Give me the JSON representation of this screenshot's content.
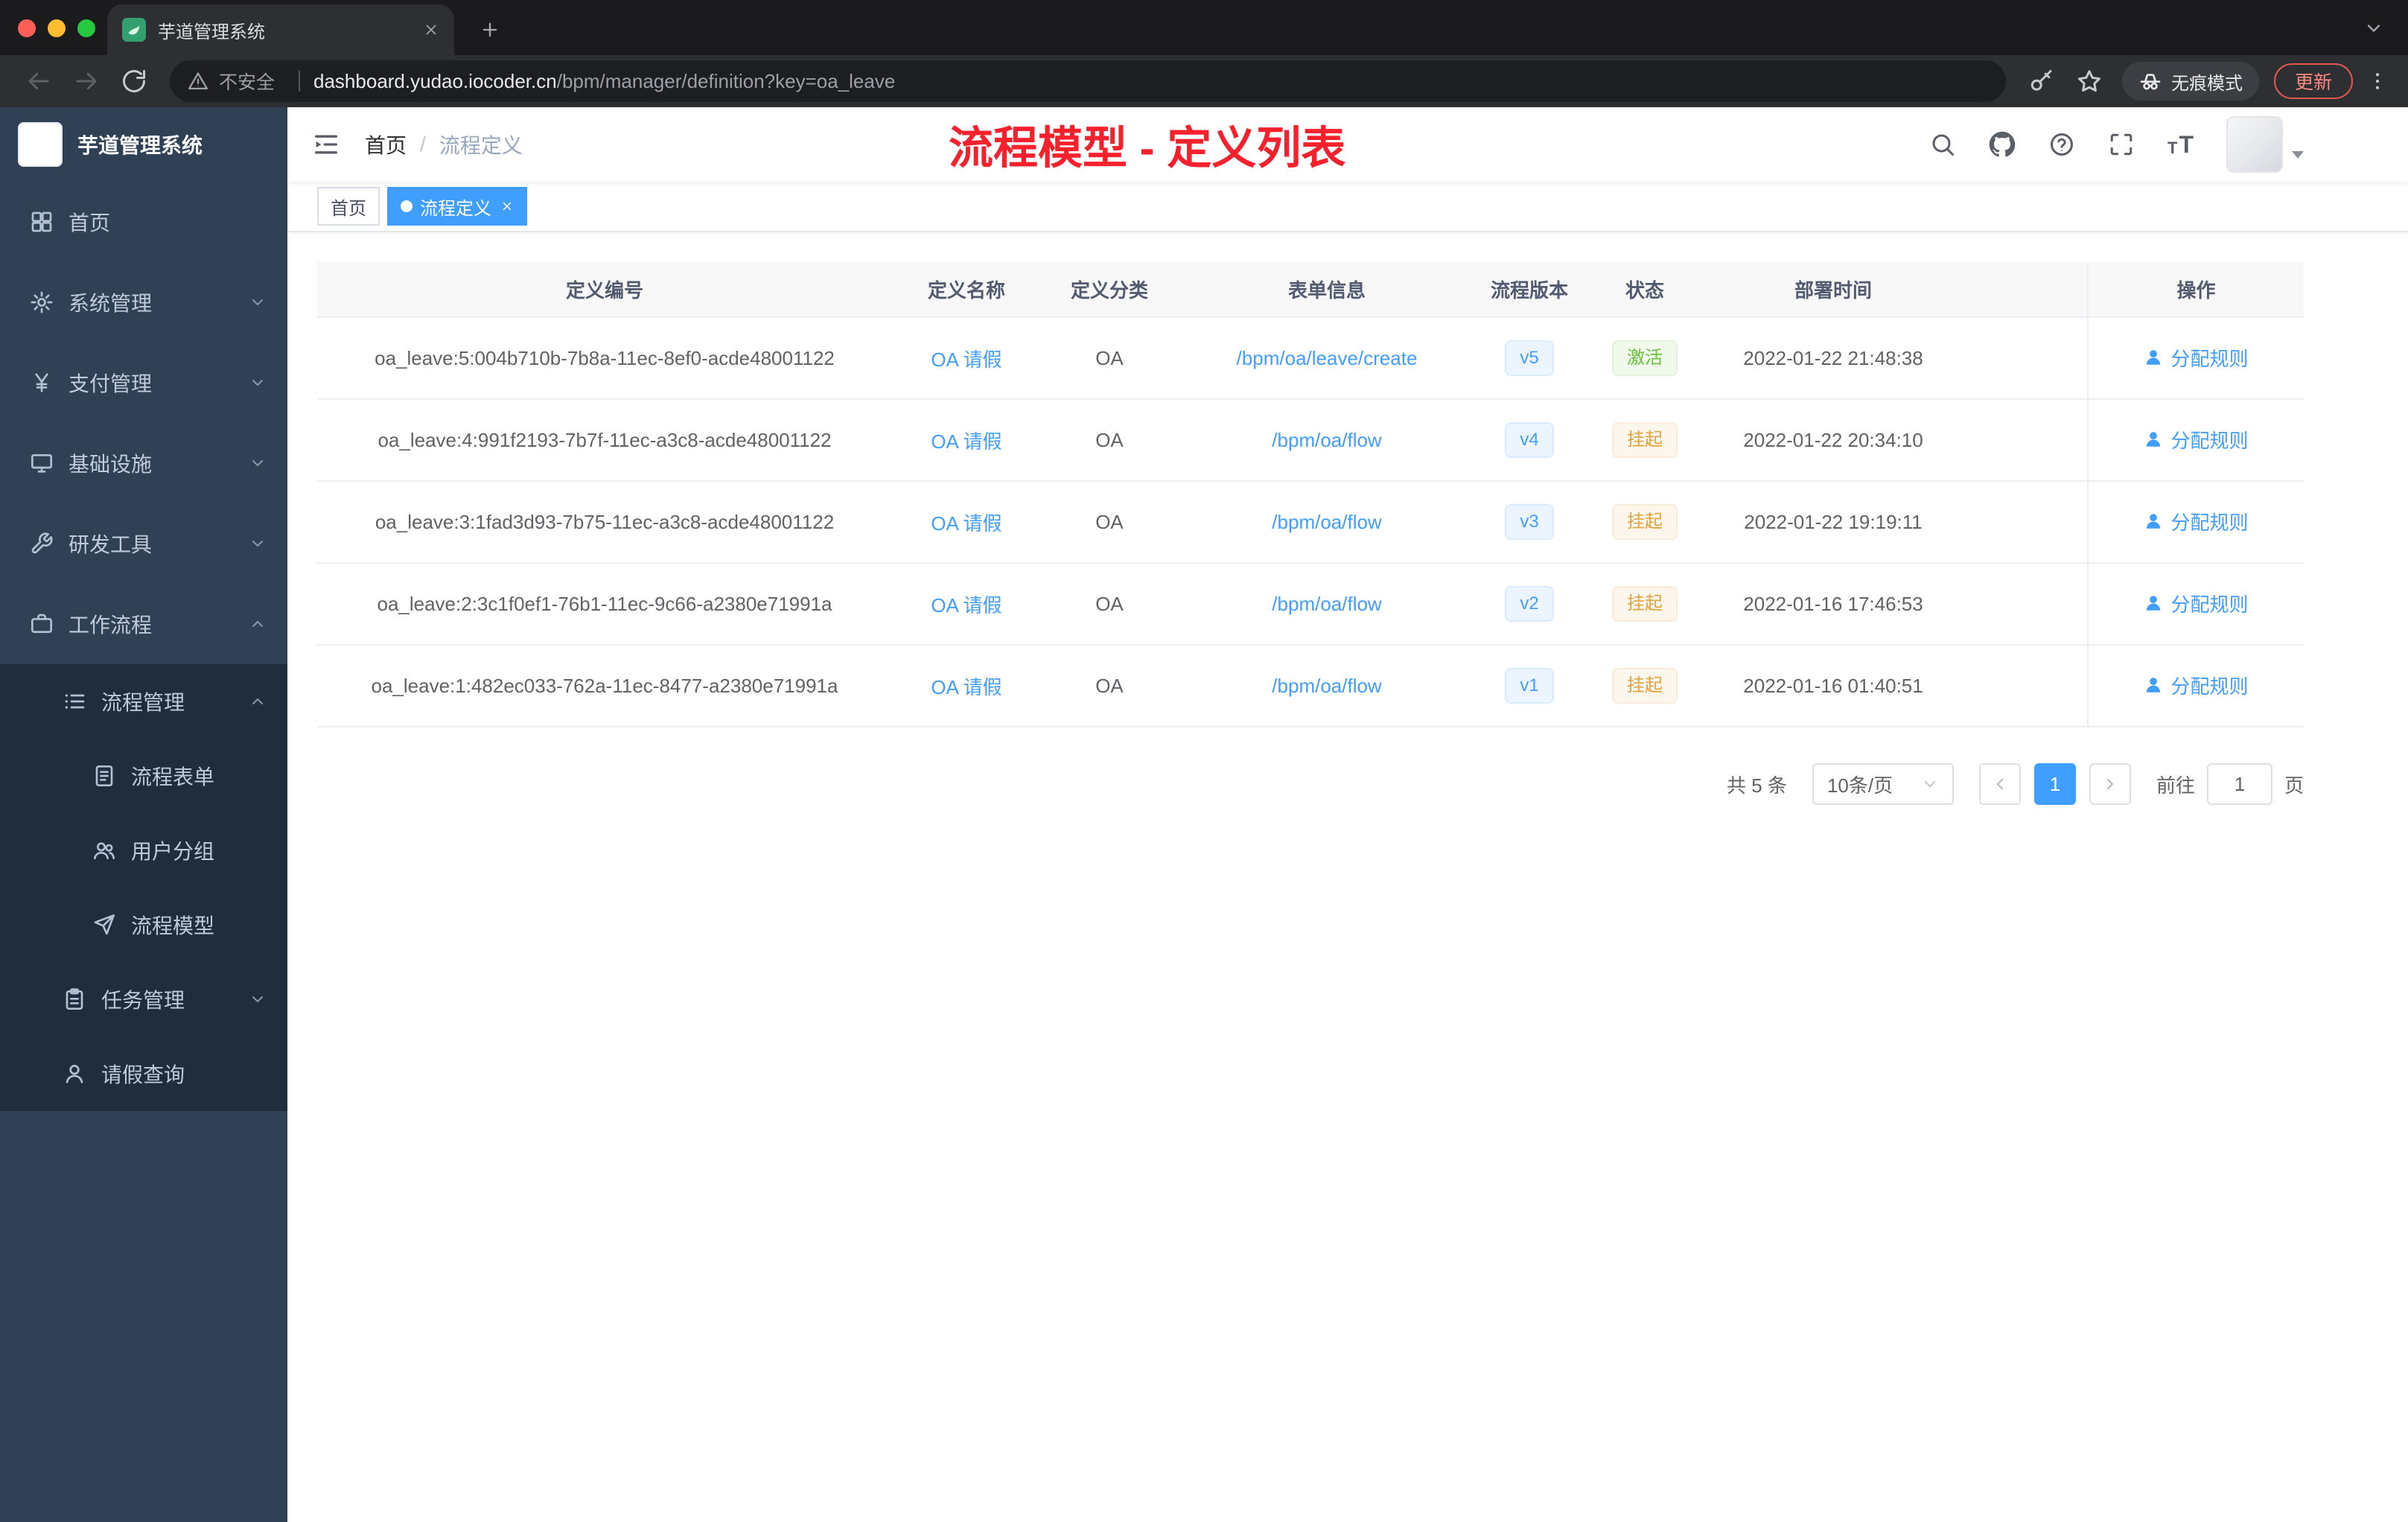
{
  "browser": {
    "tab_title": "芋道管理系统",
    "security_label": "不安全",
    "url_host": "dashboard.yudao.iocoder.cn",
    "url_path": "/bpm/manager/definition?key=oa_leave",
    "incognito_label": "无痕模式",
    "update_label": "更新"
  },
  "sidebar": {
    "logo_title": "芋道管理系统",
    "menu": [
      {
        "label": "首页",
        "icon": "home-icon",
        "level": 1,
        "arrow": "none",
        "sub": false
      },
      {
        "label": "系统管理",
        "icon": "gear-icon",
        "level": 1,
        "arrow": "down",
        "sub": false
      },
      {
        "label": "支付管理",
        "icon": "payment-icon",
        "level": 1,
        "arrow": "down",
        "sub": false
      },
      {
        "label": "基础设施",
        "icon": "infrastructure-icon",
        "level": 1,
        "arrow": "down",
        "sub": false
      },
      {
        "label": "研发工具",
        "icon": "devtools-icon",
        "level": 1,
        "arrow": "down",
        "sub": false
      },
      {
        "label": "工作流程",
        "icon": "workflow-icon",
        "level": 1,
        "arrow": "up",
        "sub": false
      },
      {
        "label": "流程管理",
        "icon": "process-manage-icon",
        "level": 2,
        "arrow": "up",
        "sub": true
      },
      {
        "label": "流程表单",
        "icon": "form-icon",
        "level": 3,
        "arrow": "none",
        "sub": true
      },
      {
        "label": "用户分组",
        "icon": "user-group-icon",
        "level": 3,
        "arrow": "none",
        "sub": true
      },
      {
        "label": "流程模型",
        "icon": "model-icon",
        "level": 3,
        "arrow": "none",
        "sub": true
      },
      {
        "label": "任务管理",
        "icon": "task-icon",
        "level": 2,
        "arrow": "down",
        "sub": true
      },
      {
        "label": "请假查询",
        "icon": "leave-query-icon",
        "level": 2,
        "arrow": "none",
        "sub": true
      }
    ]
  },
  "navbar": {
    "breadcrumb": {
      "root": "首页",
      "separator": "/",
      "current": "流程定义"
    },
    "annotation": "流程模型 - 定义列表"
  },
  "tags": [
    {
      "label": "首页",
      "active": false
    },
    {
      "label": "流程定义",
      "active": true
    }
  ],
  "table": {
    "headers": [
      "定义编号",
      "定义名称",
      "定义分类",
      "表单信息",
      "流程版本",
      "状态",
      "部署时间",
      "操作"
    ],
    "rows": [
      {
        "id": "oa_leave:5:004b710b-7b8a-11ec-8ef0-acde48001122",
        "name": "OA 请假",
        "category": "OA",
        "form": "/bpm/oa/leave/create",
        "version": "v5",
        "status": "激活",
        "status_type": "success",
        "deploy_time": "2022-01-22 21:48:38",
        "action": "分配规则"
      },
      {
        "id": "oa_leave:4:991f2193-7b7f-11ec-a3c8-acde48001122",
        "name": "OA 请假",
        "category": "OA",
        "form": "/bpm/oa/flow",
        "version": "v4",
        "status": "挂起",
        "status_type": "warning",
        "deploy_time": "2022-01-22 20:34:10",
        "action": "分配规则"
      },
      {
        "id": "oa_leave:3:1fad3d93-7b75-11ec-a3c8-acde48001122",
        "name": "OA 请假",
        "category": "OA",
        "form": "/bpm/oa/flow",
        "version": "v3",
        "status": "挂起",
        "status_type": "warning",
        "deploy_time": "2022-01-22 19:19:11",
        "action": "分配规则"
      },
      {
        "id": "oa_leave:2:3c1f0ef1-76b1-11ec-9c66-a2380e71991a",
        "name": "OA 请假",
        "category": "OA",
        "form": "/bpm/oa/flow",
        "version": "v2",
        "status": "挂起",
        "status_type": "warning",
        "deploy_time": "2022-01-16 17:46:53",
        "action": "分配规则"
      },
      {
        "id": "oa_leave:1:482ec033-762a-11ec-8477-a2380e71991a",
        "name": "OA 请假",
        "category": "OA",
        "form": "/bpm/oa/flow",
        "version": "v1",
        "status": "挂起",
        "status_type": "warning",
        "deploy_time": "2022-01-16 01:40:51",
        "action": "分配规则"
      }
    ]
  },
  "pagination": {
    "total": "共 5 条",
    "page_size": "10条/页",
    "current_page": "1",
    "goto_label": "前往",
    "goto_value": "1",
    "page_unit": "页"
  },
  "colors": {
    "accent": "#409eff",
    "annotation_red": "#f5222d",
    "success": "#67c23a",
    "warning": "#e6a23c",
    "sidebar_bg": "#304156",
    "submenu_bg": "#1f2d3d"
  }
}
